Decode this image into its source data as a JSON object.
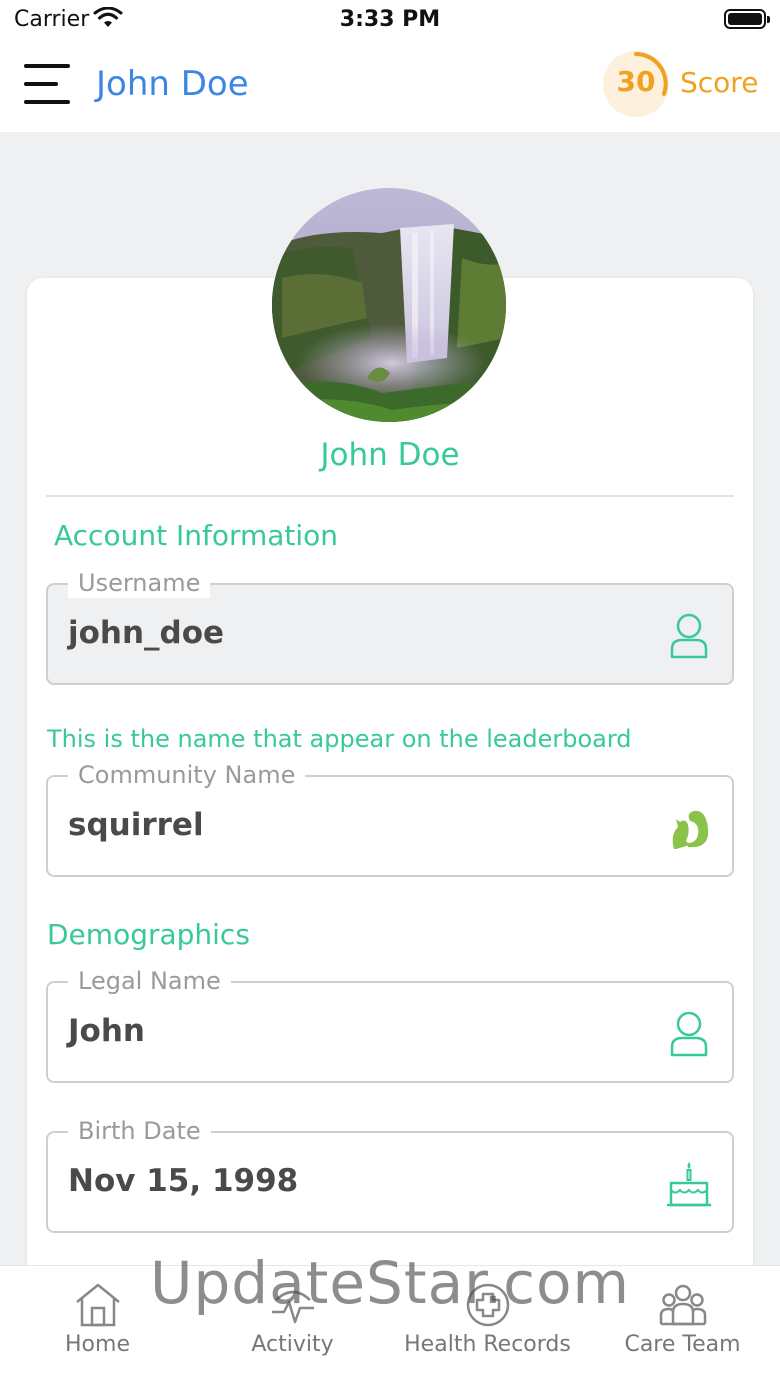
{
  "status_bar": {
    "carrier": "Carrier",
    "time": "3:33 PM"
  },
  "navbar": {
    "title": "John Doe",
    "score_value": "30",
    "score_label": "Score"
  },
  "profile": {
    "name": "John Doe"
  },
  "account_section": {
    "title": "Account Information"
  },
  "username": {
    "label": "Username",
    "value": "john_doe"
  },
  "community": {
    "hint": "This is the name that appear on the leaderboard",
    "label": "Community Name",
    "value": "squirrel"
  },
  "demographics_section": {
    "title": "Demographics"
  },
  "legal_name": {
    "label": "Legal Name",
    "value": "John"
  },
  "birth_date": {
    "label": "Birth Date",
    "value": "Nov 15, 1998"
  },
  "tabs": [
    {
      "label": "Home",
      "icon": "home-icon"
    },
    {
      "label": "Activity",
      "icon": "activity-icon"
    },
    {
      "label": "Health Records",
      "icon": "health-records-icon"
    },
    {
      "label": "Care Team",
      "icon": "care-team-icon"
    }
  ],
  "watermark": "UpdateStar.com",
  "colors": {
    "accent_green": "#38c99a",
    "title_blue": "#3b86e6",
    "score_orange": "#f0a21e"
  }
}
